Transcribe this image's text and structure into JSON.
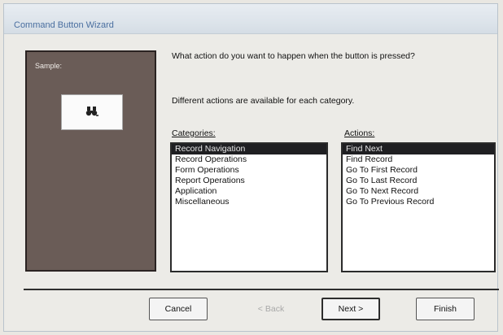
{
  "window": {
    "title": "Command Button Wizard"
  },
  "sample": {
    "label": "Sample:",
    "button_icon": "binoculars-icon"
  },
  "prompt": {
    "question": "What action do you want to happen when the button is pressed?",
    "subtext": "Different actions are available for each category."
  },
  "categories": {
    "label": "Categories:",
    "items": [
      {
        "label": "Record Navigation",
        "selected": true
      },
      {
        "label": "Record Operations",
        "selected": false
      },
      {
        "label": "Form Operations",
        "selected": false
      },
      {
        "label": "Report Operations",
        "selected": false
      },
      {
        "label": "Application",
        "selected": false
      },
      {
        "label": "Miscellaneous",
        "selected": false
      }
    ]
  },
  "actions": {
    "label": "Actions:",
    "items": [
      {
        "label": "Find Next",
        "selected": true
      },
      {
        "label": "Find Record",
        "selected": false
      },
      {
        "label": "Go To First Record",
        "selected": false
      },
      {
        "label": "Go To Last Record",
        "selected": false
      },
      {
        "label": "Go To Next Record",
        "selected": false
      },
      {
        "label": "Go To Previous Record",
        "selected": false
      }
    ]
  },
  "buttons": {
    "cancel": "Cancel",
    "back": "< Back",
    "next": "Next >",
    "finish": "Finish"
  },
  "colors": {
    "selection": "#1f1f22",
    "sample_bg": "#6a5c57",
    "title_text": "#4a6fa0"
  }
}
